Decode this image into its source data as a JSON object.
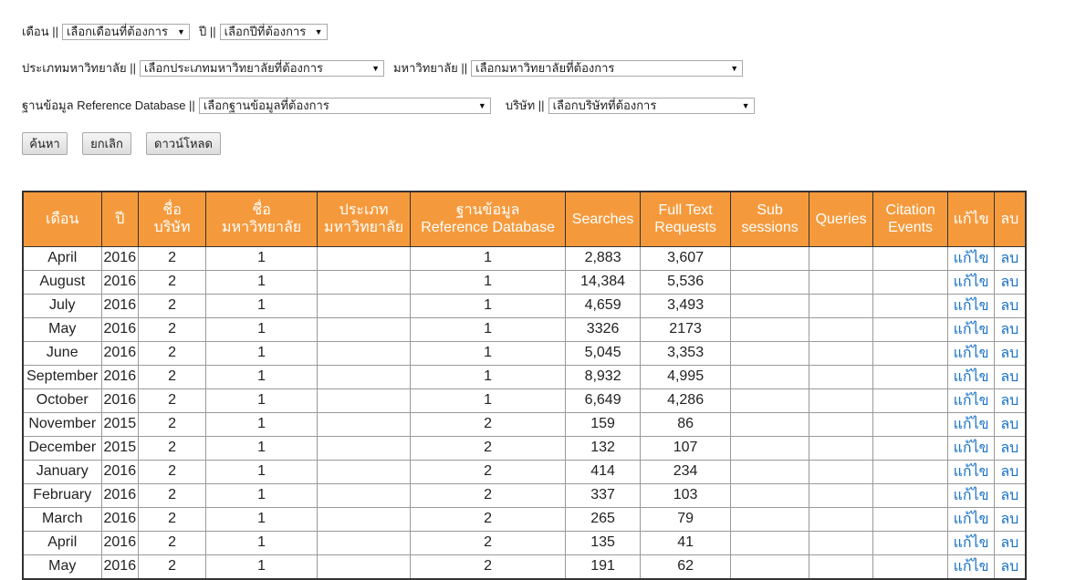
{
  "filters": {
    "month_label": "เดือน ||",
    "month_select": "เลือกเดือนที่ต้องการ",
    "year_label": "ปี ||",
    "year_select": "เลือกปีที่ต้องการ",
    "univ_type_label": "ประเภทมหาวิทยาลัย ||",
    "univ_type_select": "เลือกประเภทมหาวิทยาลัยที่ต้องการ",
    "univ_label": "มหาวิทยาลัย ||",
    "univ_select": "เลือกมหาวิทยาลัยที่ต้องการ",
    "db_label": "ฐานข้อมูล Reference Database ||",
    "db_select": "เลือกฐานข้อมูลที่ต้องการ",
    "company_label": "บริษัท ||",
    "company_select": "เลือกบริษัทที่ต้องการ"
  },
  "buttons": {
    "search": "ค้นหา",
    "cancel": "ยกเลิก",
    "download": "ดาวน์โหลด"
  },
  "table": {
    "headers": {
      "month": "เดือน",
      "year": "ปี",
      "company_1": "ชื่อ",
      "company_2": "บริษัท",
      "university_1": "ชื่อ",
      "university_2": "มหาวิทยาลัย",
      "univ_type_1": "ประเภท",
      "univ_type_2": "มหาวิทยาลัย",
      "database_1": "ฐานข้อมูล",
      "database_2": "Reference Database",
      "searches": "Searches",
      "fulltext_1": "Full Text",
      "fulltext_2": "Requests",
      "sub_1": "Sub",
      "sub_2": "sessions",
      "queries": "Queries",
      "citation_1": "Citation",
      "citation_2": "Events",
      "edit": "แก้ไข",
      "delete": "ลบ"
    },
    "rows": [
      {
        "month": "April",
        "year": "2016",
        "company": "2",
        "university": "1",
        "univ_type": "",
        "database": "1",
        "searches": "2,883",
        "fulltext": "3,607",
        "sub": "",
        "queries": "",
        "citation": "",
        "edit": "แก้ไข",
        "delete": "ลบ"
      },
      {
        "month": "August",
        "year": "2016",
        "company": "2",
        "university": "1",
        "univ_type": "",
        "database": "1",
        "searches": "14,384",
        "fulltext": "5,536",
        "sub": "",
        "queries": "",
        "citation": "",
        "edit": "แก้ไข",
        "delete": "ลบ"
      },
      {
        "month": "July",
        "year": "2016",
        "company": "2",
        "university": "1",
        "univ_type": "",
        "database": "1",
        "searches": "4,659",
        "fulltext": "3,493",
        "sub": "",
        "queries": "",
        "citation": "",
        "edit": "แก้ไข",
        "delete": "ลบ"
      },
      {
        "month": "May",
        "year": "2016",
        "company": "2",
        "university": "1",
        "univ_type": "",
        "database": "1",
        "searches": "3326",
        "fulltext": "2173",
        "sub": "",
        "queries": "",
        "citation": "",
        "edit": "แก้ไข",
        "delete": "ลบ"
      },
      {
        "month": "June",
        "year": "2016",
        "company": "2",
        "university": "1",
        "univ_type": "",
        "database": "1",
        "searches": "5,045",
        "fulltext": "3,353",
        "sub": "",
        "queries": "",
        "citation": "",
        "edit": "แก้ไข",
        "delete": "ลบ"
      },
      {
        "month": "September",
        "year": "2016",
        "company": "2",
        "university": "1",
        "univ_type": "",
        "database": "1",
        "searches": "8,932",
        "fulltext": "4,995",
        "sub": "",
        "queries": "",
        "citation": "",
        "edit": "แก้ไข",
        "delete": "ลบ"
      },
      {
        "month": "October",
        "year": "2016",
        "company": "2",
        "university": "1",
        "univ_type": "",
        "database": "1",
        "searches": "6,649",
        "fulltext": "4,286",
        "sub": "",
        "queries": "",
        "citation": "",
        "edit": "แก้ไข",
        "delete": "ลบ"
      },
      {
        "month": "November",
        "year": "2015",
        "company": "2",
        "university": "1",
        "univ_type": "",
        "database": "2",
        "searches": "159",
        "fulltext": "86",
        "sub": "",
        "queries": "",
        "citation": "",
        "edit": "แก้ไข",
        "delete": "ลบ"
      },
      {
        "month": "December",
        "year": "2015",
        "company": "2",
        "university": "1",
        "univ_type": "",
        "database": "2",
        "searches": "132",
        "fulltext": "107",
        "sub": "",
        "queries": "",
        "citation": "",
        "edit": "แก้ไข",
        "delete": "ลบ"
      },
      {
        "month": "January",
        "year": "2016",
        "company": "2",
        "university": "1",
        "univ_type": "",
        "database": "2",
        "searches": "414",
        "fulltext": "234",
        "sub": "",
        "queries": "",
        "citation": "",
        "edit": "แก้ไข",
        "delete": "ลบ"
      },
      {
        "month": "February",
        "year": "2016",
        "company": "2",
        "university": "1",
        "univ_type": "",
        "database": "2",
        "searches": "337",
        "fulltext": "103",
        "sub": "",
        "queries": "",
        "citation": "",
        "edit": "แก้ไข",
        "delete": "ลบ"
      },
      {
        "month": "March",
        "year": "2016",
        "company": "2",
        "university": "1",
        "univ_type": "",
        "database": "2",
        "searches": "265",
        "fulltext": "79",
        "sub": "",
        "queries": "",
        "citation": "",
        "edit": "แก้ไข",
        "delete": "ลบ"
      },
      {
        "month": "April",
        "year": "2016",
        "company": "2",
        "university": "1",
        "univ_type": "",
        "database": "2",
        "searches": "135",
        "fulltext": "41",
        "sub": "",
        "queries": "",
        "citation": "",
        "edit": "แก้ไข",
        "delete": "ลบ"
      },
      {
        "month": "May",
        "year": "2016",
        "company": "2",
        "university": "1",
        "univ_type": "",
        "database": "2",
        "searches": "191",
        "fulltext": "62",
        "sub": "",
        "queries": "",
        "citation": "",
        "edit": "แก้ไข",
        "delete": "ลบ"
      }
    ]
  }
}
